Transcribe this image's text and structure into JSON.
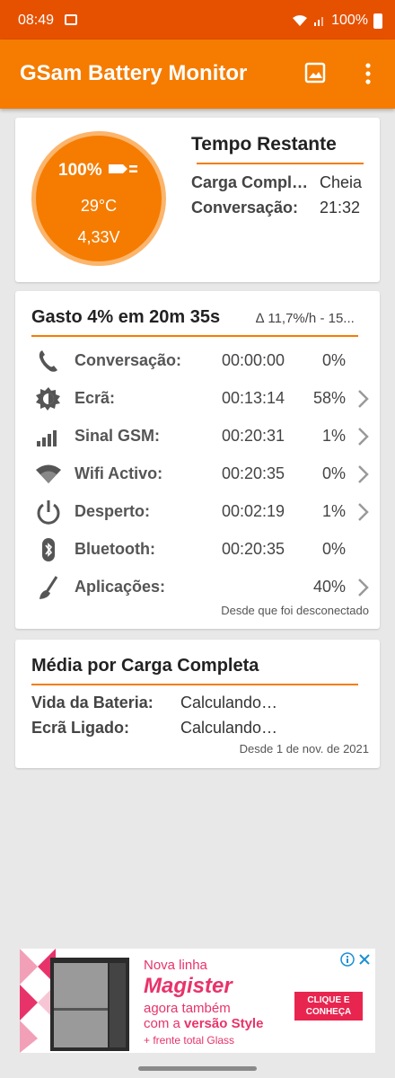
{
  "status_bar": {
    "time": "08:49",
    "battery": "100%"
  },
  "app_bar": {
    "title": "GSam Battery Monitor",
    "icons": [
      "image-icon",
      "more-vert-icon"
    ]
  },
  "gauge": {
    "percent": "100%",
    "temperature": "29°C",
    "voltage": "4,33V"
  },
  "remaining": {
    "title": "Tempo Restante",
    "rows": [
      {
        "label": "Carga Compl…",
        "value": "Cheia"
      },
      {
        "label": "Conversação:",
        "value": "21:32"
      }
    ]
  },
  "usage": {
    "title": "Gasto 4% em 20m 35s",
    "delta": "∆ 11,7%/h - 15...",
    "rows": [
      {
        "icon": "phone-icon",
        "label": "Conversação:",
        "time": "00:00:00",
        "pct": "0%",
        "chevron": false
      },
      {
        "icon": "brightness-icon",
        "label": "Ecrã:",
        "time": "00:13:14",
        "pct": "58%",
        "chevron": true
      },
      {
        "icon": "signal-icon",
        "label": "Sinal GSM:",
        "time": "00:20:31",
        "pct": "1%",
        "chevron": true
      },
      {
        "icon": "wifi-icon",
        "label": "Wifi Activo:",
        "time": "00:20:35",
        "pct": "0%",
        "chevron": true
      },
      {
        "icon": "power-icon",
        "label": "Desperto:",
        "time": "00:02:19",
        "pct": "1%",
        "chevron": true
      },
      {
        "icon": "bluetooth-icon",
        "label": "Bluetooth:",
        "time": "00:20:35",
        "pct": "0%",
        "chevron": false
      },
      {
        "icon": "broom-icon",
        "label": "Aplicações:",
        "time": "",
        "pct": "40%",
        "chevron": true
      }
    ],
    "footer": "Desde que foi desconectado"
  },
  "average": {
    "title": "Média por Carga Completa",
    "rows": [
      {
        "label": "Vida da Bateria:",
        "value": "Calculando…"
      },
      {
        "label": "Ecrã Ligado:",
        "value": "Calculando…"
      }
    ],
    "footer": "Desde 1 de nov. de 2021"
  },
  "ad": {
    "line1": "Nova linha",
    "brand": "Magister",
    "line2": "agora também",
    "line3_pre": "com a",
    "line3_bold": "versão Style",
    "line4": "+ frente total Glass",
    "cta": "CLIQUE E CONHEÇA",
    "colors": {
      "pink": "#e8336a",
      "cta_bg": "#e8254f"
    }
  }
}
